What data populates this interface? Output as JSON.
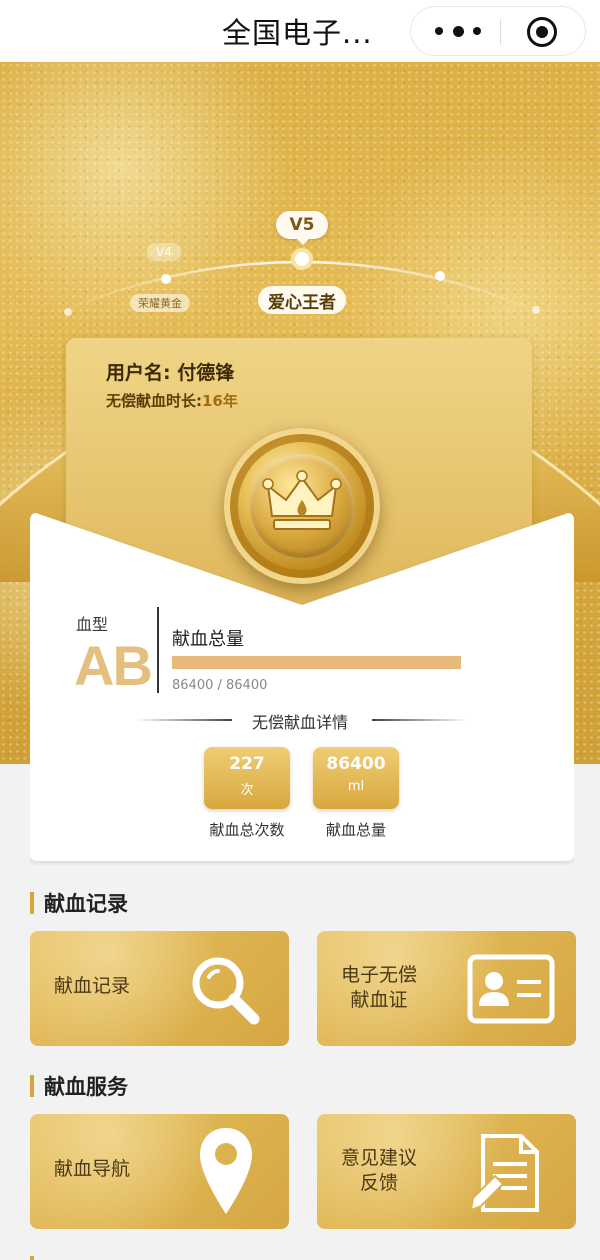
{
  "header": {
    "title": "全国电子..."
  },
  "level": {
    "current_code": "V5",
    "current_name": "爱心王者",
    "previous_code": "V4",
    "previous_name": "荣耀黄金"
  },
  "profile": {
    "username_label": "用户名:",
    "username": "付德锋",
    "duration_label": "无偿献血时长:",
    "duration_value": "16年"
  },
  "blood": {
    "type_label": "血型",
    "type": "AB",
    "total_title": "献血总量",
    "progress_text": "86400 / 86400",
    "progress_fraction": 1.0,
    "detail_title": "无偿献血详情",
    "count_value": "227",
    "count_unit": "次",
    "count_label": "献血总次数",
    "volume_value": "86400",
    "volume_unit": "ml",
    "volume_label": "献血总量"
  },
  "sections": [
    {
      "title": "献血记录",
      "tiles": [
        {
          "label": "献血记录",
          "icon": "search-icon"
        },
        {
          "label_line1": "电子无偿",
          "label_line2": "献血证",
          "icon": "id-card-icon"
        }
      ]
    },
    {
      "title": "献血服务",
      "tiles": [
        {
          "label": "献血导航",
          "icon": "location-pin-icon"
        },
        {
          "label_line1": "意见建议",
          "label_line2": "反馈",
          "icon": "feedback-document-icon"
        }
      ]
    }
  ],
  "colors": {
    "gold": "#d5a53c",
    "blood_type": "#e3bf80",
    "progress": "#e7b97a"
  }
}
